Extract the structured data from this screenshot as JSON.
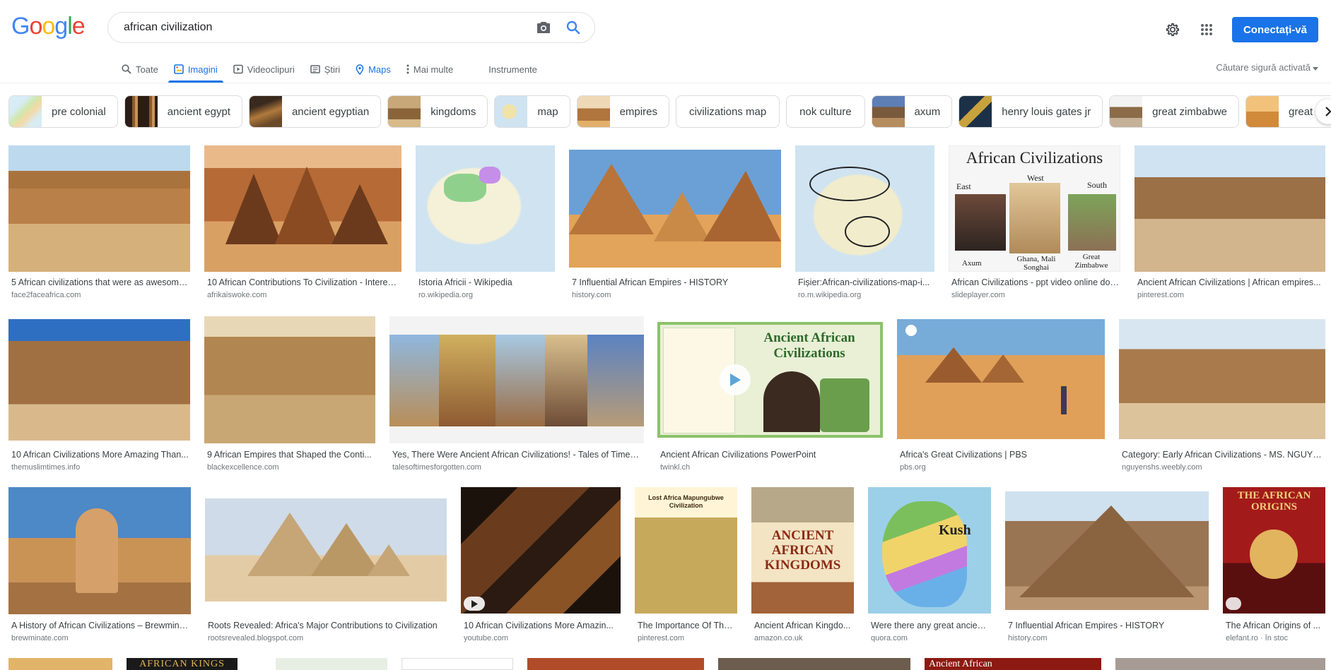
{
  "logo": {
    "letters": [
      "G",
      "o",
      "o",
      "g",
      "l",
      "e"
    ]
  },
  "search": {
    "query": "african civilization"
  },
  "header": {
    "signin_label": "Conectați-vă"
  },
  "tabs": [
    {
      "label": "Toate"
    },
    {
      "label": "Imagini"
    },
    {
      "label": "Videoclipuri"
    },
    {
      "label": "Știri"
    },
    {
      "label": "Maps"
    },
    {
      "label": "Mai multe"
    }
  ],
  "tools_label": "Instrumente",
  "safesearch_label": "Căutare sigură activată",
  "chips": [
    {
      "label": "pre colonial"
    },
    {
      "label": "ancient egypt"
    },
    {
      "label": "ancient egyptian"
    },
    {
      "label": "kingdoms"
    },
    {
      "label": "map"
    },
    {
      "label": "empires"
    },
    {
      "label": "civilizations map"
    },
    {
      "label": "nok culture"
    },
    {
      "label": "axum"
    },
    {
      "label": "henry louis gates jr"
    },
    {
      "label": "great zimbabwe"
    },
    {
      "label": "great civilizat"
    }
  ],
  "results": [
    {
      "title": "5 African civilizations that were as awesome as ...",
      "source": "face2faceafrica.com"
    },
    {
      "title": "10 African Contributions To Civilization - Interesting ...",
      "source": "afrikaiswoke.com"
    },
    {
      "title": "Istoria Africii - Wikipedia",
      "source": "ro.wikipedia.org"
    },
    {
      "title": "7 Influential African Empires - HISTORY",
      "source": "history.com"
    },
    {
      "title": "Fișier:African-civilizations-map-i...",
      "source": "ro.m.wikipedia.org"
    },
    {
      "title": "African Civilizations - ppt video online download",
      "source": "slideplayer.com"
    },
    {
      "title": "Ancient African Civilizations | African empires...",
      "source": "pinterest.com"
    },
    {
      "title": "10 African Civilizations More Amazing Than...",
      "source": "themuslimtimes.info"
    },
    {
      "title": "9 African Empires that Shaped the Conti...",
      "source": "blackexcellence.com"
    },
    {
      "title": "Yes, There Were Ancient African Civilizations! - Tales of Times ...",
      "source": "talesoftimesforgotten.com"
    },
    {
      "title": "Ancient African Civilizations PowerPoint",
      "source": "twinkl.ch"
    },
    {
      "title": "Africa's Great Civilizations | PBS",
      "source": "pbs.org"
    },
    {
      "title": "Category: Early African Civilizations - MS. NGUYE...",
      "source": "nguyenshs.weebly.com"
    },
    {
      "title": "A History of African Civilizations – Brewminate...",
      "source": "brewminate.com"
    },
    {
      "title": "Roots Revealed: Africa's Major Contributions to Civilization",
      "source": "rootsrevealed.blogspot.com"
    },
    {
      "title": "10 African Civilizations More Amazin...",
      "source": "youtube.com"
    },
    {
      "title": "The Importance Of The...",
      "source": "pinterest.com"
    },
    {
      "title": "Ancient African Kingdo...",
      "source": "amazon.co.uk"
    },
    {
      "title": "Were there any great ancient...",
      "source": "quora.com"
    },
    {
      "title": "7 Influential African Empires - HISTORY",
      "source": "history.com"
    },
    {
      "title": "The African Origins of ...",
      "source": "elefant.ro · În stoc"
    }
  ],
  "overlays": {
    "slide_title": "African Civilizations",
    "slide_regions": [
      "East",
      "West",
      "South"
    ],
    "slide_places": [
      "Axum",
      "Ghana, Mali Songhai",
      "Great Zimbabwe"
    ],
    "twinkl_title": "Ancient African Civilizations",
    "book_title": "ANCIENT AFRICAN KINGDOMS",
    "origins_title": "THE AFRICAN ORIGINS",
    "lost_africa": "Lost Africa Mapungubwe Civilization",
    "map_kush": "Kush",
    "row4_kings": "AFRICAN KINGS",
    "row4_ancient": "Ancient African"
  },
  "colors": {
    "accent": "#1a73e8",
    "text": "#202124",
    "muted": "#70757a"
  }
}
